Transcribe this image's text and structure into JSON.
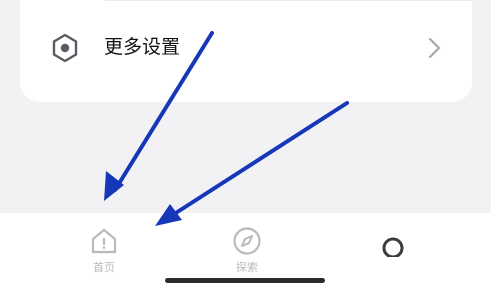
{
  "settings": {
    "more_settings_label": "更多设置"
  },
  "tabbar": {
    "home_label": "首页",
    "discover_label": "探索"
  },
  "colors": {
    "arrow": "#1637b8",
    "inactive_tab": "#b9b9bf",
    "background": "#f2f2f5",
    "card": "#ffffff"
  },
  "icons": {
    "settings_row": "hexagon-gear-icon",
    "row_chevron": "chevron-right-icon",
    "home_tab": "home-icon",
    "discover_tab": "compass-icon",
    "profile_tab": "person-icon"
  }
}
